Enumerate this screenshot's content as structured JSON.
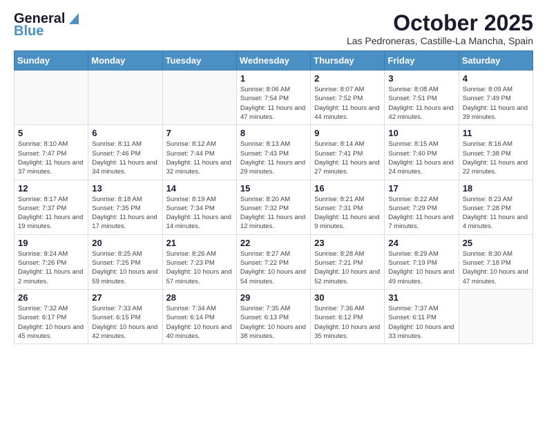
{
  "header": {
    "logo_general": "General",
    "logo_blue": "Blue",
    "month_title": "October 2025",
    "location": "Las Pedroneras, Castille-La Mancha, Spain"
  },
  "days_of_week": [
    "Sunday",
    "Monday",
    "Tuesday",
    "Wednesday",
    "Thursday",
    "Friday",
    "Saturday"
  ],
  "weeks": [
    [
      {
        "day": "",
        "sunrise": "",
        "sunset": "",
        "daylight": ""
      },
      {
        "day": "",
        "sunrise": "",
        "sunset": "",
        "daylight": ""
      },
      {
        "day": "",
        "sunrise": "",
        "sunset": "",
        "daylight": ""
      },
      {
        "day": "1",
        "sunrise": "Sunrise: 8:06 AM",
        "sunset": "Sunset: 7:54 PM",
        "daylight": "Daylight: 11 hours and 47 minutes."
      },
      {
        "day": "2",
        "sunrise": "Sunrise: 8:07 AM",
        "sunset": "Sunset: 7:52 PM",
        "daylight": "Daylight: 11 hours and 44 minutes."
      },
      {
        "day": "3",
        "sunrise": "Sunrise: 8:08 AM",
        "sunset": "Sunset: 7:51 PM",
        "daylight": "Daylight: 11 hours and 42 minutes."
      },
      {
        "day": "4",
        "sunrise": "Sunrise: 8:09 AM",
        "sunset": "Sunset: 7:49 PM",
        "daylight": "Daylight: 11 hours and 39 minutes."
      }
    ],
    [
      {
        "day": "5",
        "sunrise": "Sunrise: 8:10 AM",
        "sunset": "Sunset: 7:47 PM",
        "daylight": "Daylight: 11 hours and 37 minutes."
      },
      {
        "day": "6",
        "sunrise": "Sunrise: 8:11 AM",
        "sunset": "Sunset: 7:46 PM",
        "daylight": "Daylight: 11 hours and 34 minutes."
      },
      {
        "day": "7",
        "sunrise": "Sunrise: 8:12 AM",
        "sunset": "Sunset: 7:44 PM",
        "daylight": "Daylight: 11 hours and 32 minutes."
      },
      {
        "day": "8",
        "sunrise": "Sunrise: 8:13 AM",
        "sunset": "Sunset: 7:43 PM",
        "daylight": "Daylight: 11 hours and 29 minutes."
      },
      {
        "day": "9",
        "sunrise": "Sunrise: 8:14 AM",
        "sunset": "Sunset: 7:41 PM",
        "daylight": "Daylight: 11 hours and 27 minutes."
      },
      {
        "day": "10",
        "sunrise": "Sunrise: 8:15 AM",
        "sunset": "Sunset: 7:40 PM",
        "daylight": "Daylight: 11 hours and 24 minutes."
      },
      {
        "day": "11",
        "sunrise": "Sunrise: 8:16 AM",
        "sunset": "Sunset: 7:38 PM",
        "daylight": "Daylight: 11 hours and 22 minutes."
      }
    ],
    [
      {
        "day": "12",
        "sunrise": "Sunrise: 8:17 AM",
        "sunset": "Sunset: 7:37 PM",
        "daylight": "Daylight: 11 hours and 19 minutes."
      },
      {
        "day": "13",
        "sunrise": "Sunrise: 8:18 AM",
        "sunset": "Sunset: 7:35 PM",
        "daylight": "Daylight: 11 hours and 17 minutes."
      },
      {
        "day": "14",
        "sunrise": "Sunrise: 8:19 AM",
        "sunset": "Sunset: 7:34 PM",
        "daylight": "Daylight: 11 hours and 14 minutes."
      },
      {
        "day": "15",
        "sunrise": "Sunrise: 8:20 AM",
        "sunset": "Sunset: 7:32 PM",
        "daylight": "Daylight: 11 hours and 12 minutes."
      },
      {
        "day": "16",
        "sunrise": "Sunrise: 8:21 AM",
        "sunset": "Sunset: 7:31 PM",
        "daylight": "Daylight: 11 hours and 9 minutes."
      },
      {
        "day": "17",
        "sunrise": "Sunrise: 8:22 AM",
        "sunset": "Sunset: 7:29 PM",
        "daylight": "Daylight: 11 hours and 7 minutes."
      },
      {
        "day": "18",
        "sunrise": "Sunrise: 8:23 AM",
        "sunset": "Sunset: 7:28 PM",
        "daylight": "Daylight: 11 hours and 4 minutes."
      }
    ],
    [
      {
        "day": "19",
        "sunrise": "Sunrise: 8:24 AM",
        "sunset": "Sunset: 7:26 PM",
        "daylight": "Daylight: 11 hours and 2 minutes."
      },
      {
        "day": "20",
        "sunrise": "Sunrise: 8:25 AM",
        "sunset": "Sunset: 7:25 PM",
        "daylight": "Daylight: 10 hours and 59 minutes."
      },
      {
        "day": "21",
        "sunrise": "Sunrise: 8:26 AM",
        "sunset": "Sunset: 7:23 PM",
        "daylight": "Daylight: 10 hours and 57 minutes."
      },
      {
        "day": "22",
        "sunrise": "Sunrise: 8:27 AM",
        "sunset": "Sunset: 7:22 PM",
        "daylight": "Daylight: 10 hours and 54 minutes."
      },
      {
        "day": "23",
        "sunrise": "Sunrise: 8:28 AM",
        "sunset": "Sunset: 7:21 PM",
        "daylight": "Daylight: 10 hours and 52 minutes."
      },
      {
        "day": "24",
        "sunrise": "Sunrise: 8:29 AM",
        "sunset": "Sunset: 7:19 PM",
        "daylight": "Daylight: 10 hours and 49 minutes."
      },
      {
        "day": "25",
        "sunrise": "Sunrise: 8:30 AM",
        "sunset": "Sunset: 7:18 PM",
        "daylight": "Daylight: 10 hours and 47 minutes."
      }
    ],
    [
      {
        "day": "26",
        "sunrise": "Sunrise: 7:32 AM",
        "sunset": "Sunset: 6:17 PM",
        "daylight": "Daylight: 10 hours and 45 minutes."
      },
      {
        "day": "27",
        "sunrise": "Sunrise: 7:33 AM",
        "sunset": "Sunset: 6:15 PM",
        "daylight": "Daylight: 10 hours and 42 minutes."
      },
      {
        "day": "28",
        "sunrise": "Sunrise: 7:34 AM",
        "sunset": "Sunset: 6:14 PM",
        "daylight": "Daylight: 10 hours and 40 minutes."
      },
      {
        "day": "29",
        "sunrise": "Sunrise: 7:35 AM",
        "sunset": "Sunset: 6:13 PM",
        "daylight": "Daylight: 10 hours and 38 minutes."
      },
      {
        "day": "30",
        "sunrise": "Sunrise: 7:36 AM",
        "sunset": "Sunset: 6:12 PM",
        "daylight": "Daylight: 10 hours and 35 minutes."
      },
      {
        "day": "31",
        "sunrise": "Sunrise: 7:37 AM",
        "sunset": "Sunset: 6:11 PM",
        "daylight": "Daylight: 10 hours and 33 minutes."
      },
      {
        "day": "",
        "sunrise": "",
        "sunset": "",
        "daylight": ""
      }
    ]
  ]
}
